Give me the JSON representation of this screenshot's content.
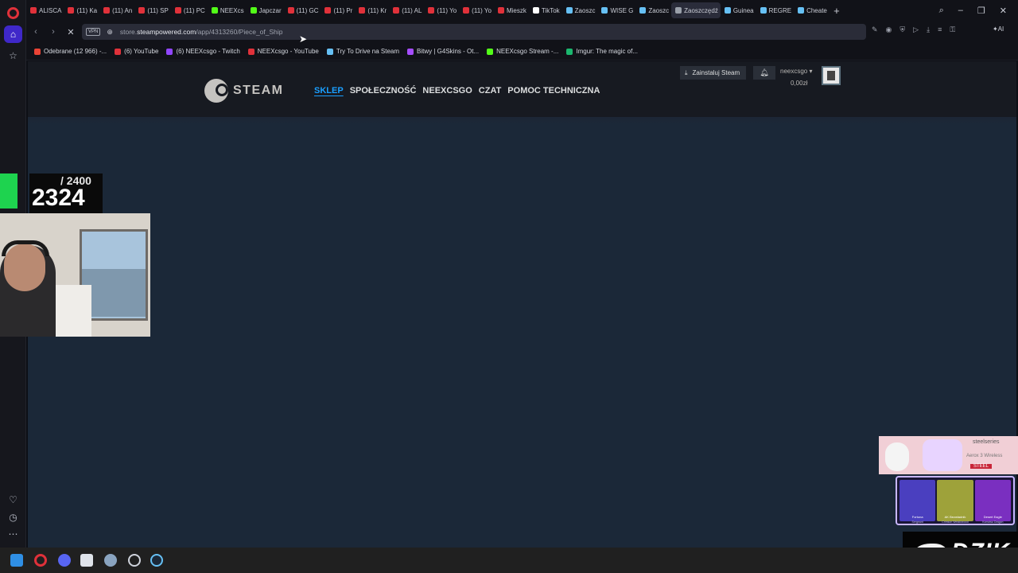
{
  "browser": {
    "tabs": [
      {
        "label": "ALISCA",
        "color": "#e0313a"
      },
      {
        "label": "(11) Ka",
        "color": "#e0313a"
      },
      {
        "label": "(11) An",
        "color": "#e0313a"
      },
      {
        "label": "(11) SP",
        "color": "#e0313a"
      },
      {
        "label": "(11) PC",
        "color": "#e0313a"
      },
      {
        "label": "NEEXcs",
        "color": "#53fc18"
      },
      {
        "label": "Japczar",
        "color": "#53fc18"
      },
      {
        "label": "(11) GC",
        "color": "#e0313a"
      },
      {
        "label": "(11) Pr",
        "color": "#e0313a"
      },
      {
        "label": "(11) Kr",
        "color": "#e0313a"
      },
      {
        "label": "(11) AL",
        "color": "#e0313a"
      },
      {
        "label": "(11) Yo",
        "color": "#e0313a"
      },
      {
        "label": "(11) Yo",
        "color": "#e0313a"
      },
      {
        "label": "Mieszk",
        "color": "#e0313a"
      },
      {
        "label": "TikTok",
        "color": "#ffffff"
      },
      {
        "label": "Zaoszc",
        "color": "#66c0f4"
      },
      {
        "label": "WISE G",
        "color": "#66c0f4"
      },
      {
        "label": "Zaoszc",
        "color": "#66c0f4"
      },
      {
        "label": "Zaoszczędź",
        "color": "#9aa0aa",
        "active": true
      },
      {
        "label": "Guinea",
        "color": "#66c0f4"
      },
      {
        "label": "REGRE",
        "color": "#66c0f4"
      },
      {
        "label": "Cheate",
        "color": "#66c0f4"
      }
    ],
    "new_tab_label": "+",
    "url_prefix": "store.",
    "url_domain": "steampowered.com",
    "url_path": "/app/4313260/Piece_of_Ship",
    "vpn_label": "VPN",
    "ai_label": "Aria AI",
    "ai_short": "AI",
    "bookmarks": [
      {
        "label": "Odebrane (12 966) -...",
        "color": "#ea4335"
      },
      {
        "label": "(6) YouTube",
        "color": "#e0313a"
      },
      {
        "label": "(6) NEEXcsgo - Twitch",
        "color": "#9146ff"
      },
      {
        "label": "NEEXcsgo - YouTube",
        "color": "#e0313a"
      },
      {
        "label": "Try To Drive na Steam",
        "color": "#66c0f4"
      },
      {
        "label": "Bitwy | G4Skins - Ot...",
        "color": "#a64dff"
      },
      {
        "label": "NEEXcsgo Stream -...",
        "color": "#53fc18"
      },
      {
        "label": "Imgur: The magic of...",
        "color": "#1bb76e"
      }
    ]
  },
  "steam": {
    "logo_text": "STEAM",
    "nav": [
      {
        "label": "SKLEP",
        "active": true
      },
      {
        "label": "SPOŁECZNOŚĆ",
        "active": false
      },
      {
        "label": "NEEXCSGO",
        "active": false
      },
      {
        "label": "CZAT",
        "active": false
      },
      {
        "label": "POMOC TECHNICZNA",
        "active": false
      }
    ],
    "install_label": "Zainstaluj Steam",
    "account_name": "neexcsgo",
    "wallet": "0,00zł"
  },
  "overlay": {
    "goal": "/ 2400",
    "count": "2324",
    "ad_brand": "steelseries",
    "ad_product": "Aerox 3 Wireless",
    "ad_tag": "STEEL",
    "skins": [
      {
        "name": "Fortuna",
        "sub": "Sergeant",
        "color": "#4a3fbf"
      },
      {
        "name": "AK Bezwładnik",
        "sub": "Crimson Weadowood",
        "color": "#9ea23a"
      },
      {
        "name": "Desert Eagle",
        "sub": "Komotsu Dragon",
        "color": "#7a2fc0"
      }
    ],
    "dzik_label": "DZIK"
  }
}
